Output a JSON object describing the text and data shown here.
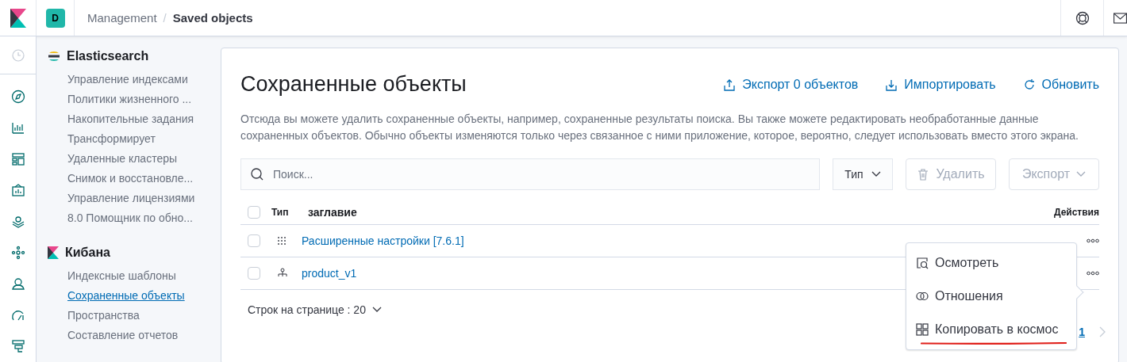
{
  "header": {
    "space_badge": "D",
    "separator": "/",
    "breadcrumbs": [
      {
        "label": "Management",
        "current": false
      },
      {
        "label": "Saved objects",
        "current": true
      }
    ]
  },
  "sidebar": {
    "sections": [
      {
        "kind": "elasticsearch",
        "title": "Elasticsearch",
        "items": [
          {
            "label": "Управление индексами",
            "selected": false
          },
          {
            "label": "Политики жизненного ...",
            "selected": false
          },
          {
            "label": "Накопительные задания",
            "selected": false
          },
          {
            "label": "Трансформирует",
            "selected": false
          },
          {
            "label": "Удаленные кластеры",
            "selected": false
          },
          {
            "label": "Снимок и восстановле...",
            "selected": false
          },
          {
            "label": "Управление лицензиями",
            "selected": false
          },
          {
            "label": "8.0 Помощник по обно...",
            "selected": false
          }
        ]
      },
      {
        "kind": "kibana",
        "title": "Кибана",
        "items": [
          {
            "label": "Индексные шаблоны",
            "selected": false
          },
          {
            "label": "Сохраненные объекты",
            "selected": true
          },
          {
            "label": "Пространства",
            "selected": false
          },
          {
            "label": "Составление отчетов",
            "selected": false
          }
        ]
      }
    ]
  },
  "main": {
    "title": "Сохраненные объекты",
    "actions": [
      {
        "kind": "export",
        "label": "Экспорт 0 объектов"
      },
      {
        "kind": "import",
        "label": "Импортировать"
      },
      {
        "kind": "refresh",
        "label": "Обновить"
      }
    ],
    "description": "Отсюда вы можете удалить сохраненные объекты, например, сохраненные результаты поиска. Вы также можете редактировать необработанные данные сохраненных объектов. Обычно объекты изменяются только через связанное с ними приложение, которое, вероятно, следует использовать вместо этого экрана.",
    "search": {
      "placeholder": "Поиск..."
    },
    "type_filter": "Тип",
    "delete_button": {
      "label": "Удалить",
      "disabled": true
    },
    "export_button": {
      "label": "Экспорт",
      "disabled": true
    },
    "table": {
      "columns": [
        "Тип",
        "заглавие",
        "Действия"
      ],
      "all_checked": false,
      "rows": [
        {
          "kind": "config",
          "title": "Расширенные настройки [7.6.1]",
          "checked": false
        },
        {
          "kind": "index-pattern",
          "title": "product_v1",
          "checked": false
        }
      ]
    },
    "pagination": {
      "rows_per_page": "Строк на странице : 20",
      "page": "1"
    },
    "popover": {
      "items": [
        {
          "kind": "inspect",
          "label": "Осмотреть",
          "underlined": false
        },
        {
          "kind": "relationships",
          "label": "Отношения",
          "underlined": false
        },
        {
          "kind": "copy",
          "label": "Копировать в космос",
          "underlined": true
        }
      ]
    }
  }
}
